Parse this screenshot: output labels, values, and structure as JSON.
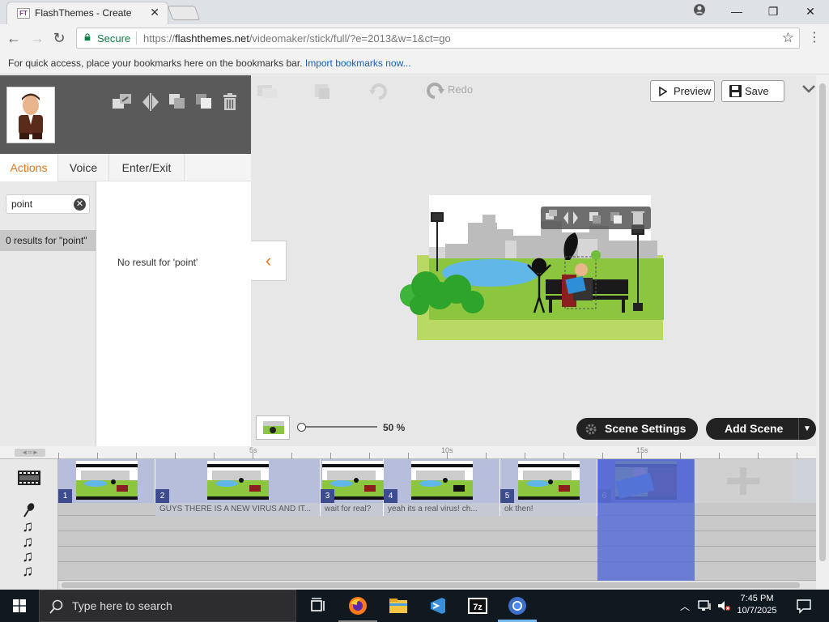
{
  "browser": {
    "tab_title": "FlashThemes - Create",
    "favicon_text": "FT",
    "secure_label": "Secure",
    "url_prefix": "https://",
    "url_host": "flashthemes.net",
    "url_path": "/videomaker/stick/full/?e=2013&w=1&ct=go",
    "bookmarks_hint": "For quick access, place your bookmarks here on the bookmarks bar.",
    "bookmarks_link": "Import bookmarks now..."
  },
  "toolbar": {
    "redo_label": "Redo",
    "preview_label": "Preview",
    "save_label": "Save"
  },
  "left_panel": {
    "tabs": [
      {
        "label": "Actions",
        "active": true
      },
      {
        "label": "Voice",
        "active": false
      },
      {
        "label": "Enter/Exit",
        "active": false
      }
    ],
    "search_value": "point",
    "results_count": "0 results for \"point\"",
    "no_result_text": "No result for 'point'"
  },
  "zoom": {
    "value": "50 %",
    "level": 0.5
  },
  "scene_buttons": {
    "scene_settings": "Scene Settings",
    "add_scene": "Add Scene"
  },
  "timeline": {
    "ruler_labels": [
      "5s",
      "10s",
      "15s"
    ],
    "scenes": [
      {
        "num": "1",
        "selected": false
      },
      {
        "num": "2",
        "selected": false
      },
      {
        "num": "3",
        "selected": false
      },
      {
        "num": "4",
        "selected": false
      },
      {
        "num": "5",
        "selected": false
      },
      {
        "num": "6",
        "selected": true
      }
    ],
    "voice_clips": [
      "GUYS THERE IS A NEW VIRUS AND IT...",
      "wait for real?",
      "yeah its a real virus! ch...",
      "ok then!"
    ]
  },
  "taskbar": {
    "search_placeholder": "Type here to search",
    "time": "7:45 PM",
    "date": "10/7/2025"
  },
  "colors": {
    "accent_orange": "#e0761b",
    "scene_selected": "#5b6fd6",
    "taskbar": "#101820"
  }
}
